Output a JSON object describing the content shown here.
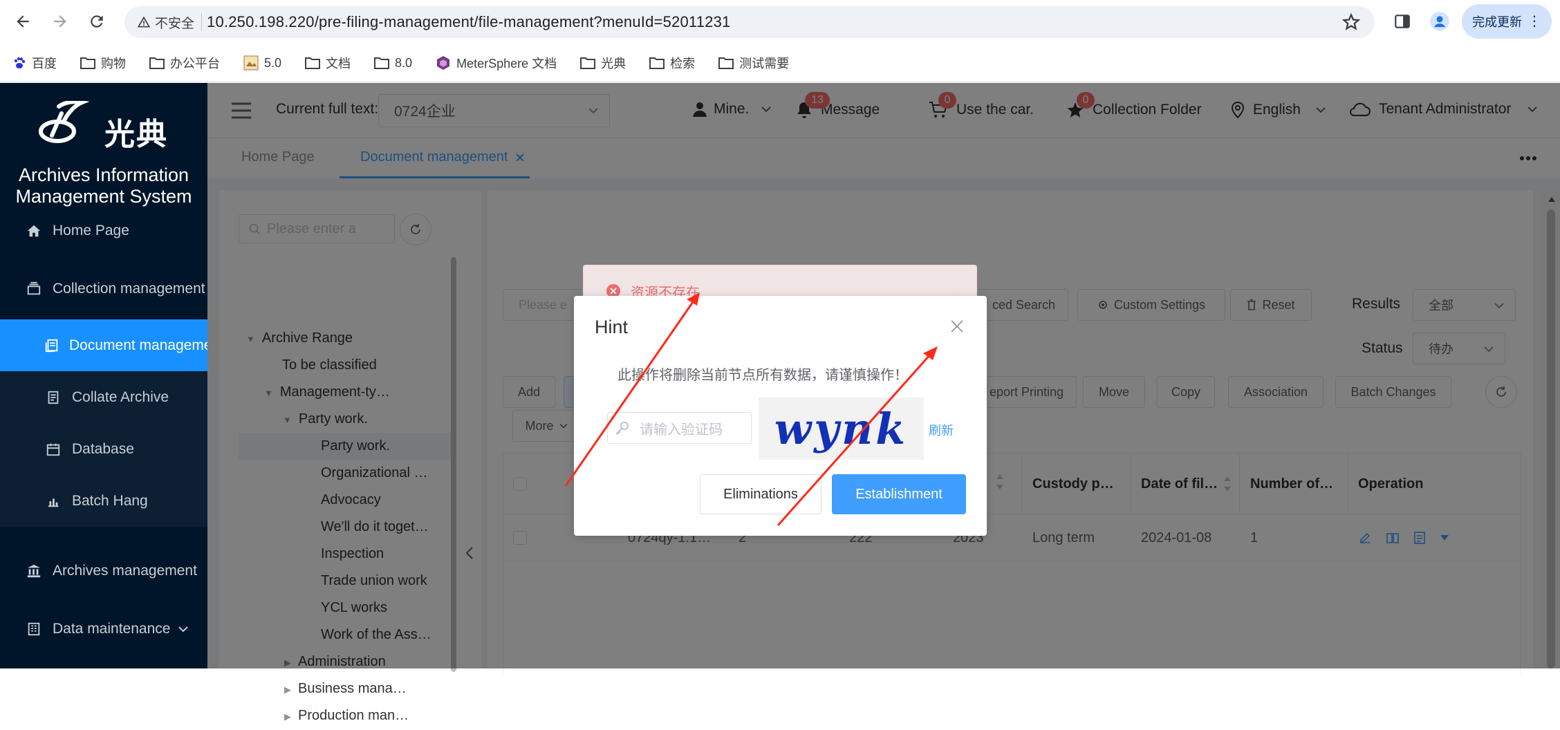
{
  "browser": {
    "security_label": "不安全",
    "url": "10.250.198.220/pre-filing-management/file-management?menuId=52011231",
    "update_label": "完成更新",
    "bookmarks": [
      "百度",
      "购物",
      "办公平台",
      "5.0",
      "文档",
      "8.0",
      "MeterSphere 文档",
      "光典",
      "检索",
      "测试需要"
    ]
  },
  "sidebar": {
    "logo_text": "光典",
    "system_title_line1": "Archives Information",
    "system_title_line2": "Management System",
    "items": [
      {
        "label": "Home Page",
        "icon": "home-icon"
      },
      {
        "label": "Collection management",
        "icon": "archive-box-icon"
      },
      {
        "label": "Document management",
        "icon": "documents-icon"
      },
      {
        "label": "Collate Archive",
        "icon": "file-icon"
      },
      {
        "label": "Database",
        "icon": "calendar-icon"
      },
      {
        "label": "Batch Hang",
        "icon": "bar-chart-icon"
      },
      {
        "label": "Archives management",
        "icon": "bank-icon"
      },
      {
        "label": "Data maintenance",
        "icon": "building-icon"
      }
    ]
  },
  "header": {
    "full_text_label": "Current full text:",
    "full_text_value": "0724企业",
    "mine_label": "Mine.",
    "message_label": "Message",
    "message_count": "13",
    "car_label": "Use the car.",
    "car_count": "0",
    "collection_label": "Collection Folder",
    "collection_count": "0",
    "language_label": "English",
    "tenant_label": "Tenant Administrator"
  },
  "tabs": [
    {
      "label": "Home Page"
    },
    {
      "label": "Document management"
    }
  ],
  "tree": {
    "search_placeholder": "Please enter a",
    "nodes": [
      {
        "label": "Archive Range"
      },
      {
        "label": "To be classified"
      },
      {
        "label": "Management-ty…"
      },
      {
        "label": "Party work."
      },
      {
        "label": "Party work."
      },
      {
        "label": "Organizational …"
      },
      {
        "label": "Advocacy"
      },
      {
        "label": "We'll do it toget…"
      },
      {
        "label": "Inspection"
      },
      {
        "label": "Trade union work"
      },
      {
        "label": "YCL works"
      },
      {
        "label": "Work of the Ass…"
      },
      {
        "label": "Administration"
      },
      {
        "label": "Business mana…"
      },
      {
        "label": "Production man…"
      }
    ]
  },
  "toolbar": {
    "search_placeholder": "Please e",
    "advanced_search": "ced Search",
    "custom_settings": "Custom Settings",
    "reset": "Reset",
    "results_label": "Results",
    "results_value": "全部",
    "status_label": "Status",
    "status_value": "待办",
    "add": "Add",
    "report_printing": "eport Printing",
    "move": "Move",
    "copy": "Copy",
    "association": "Association",
    "batch_changes": "Batch Changes",
    "more": "More"
  },
  "table": {
    "headers": [
      "Custody p…",
      "Date of fil…",
      "Number of…",
      "Operation"
    ],
    "row": {
      "code": "0724qy-1.1…",
      "c2": "2",
      "c3": "222",
      "c4": "2023",
      "custody": "Long term",
      "date": "2024-01-08",
      "number": "1"
    }
  },
  "toast": {
    "message": "资源不存在"
  },
  "dialog": {
    "title": "Hint",
    "message": "此操作将删除当前节点所有数据，请谨慎操作！",
    "captcha_placeholder": "请输入验证码",
    "captcha_text": "wynk",
    "refresh_label": "刷新",
    "cancel_label": "Eliminations",
    "confirm_label": "Establishment"
  },
  "colors": {
    "primary": "#409eff",
    "sidebar": "#001529",
    "active": "#1890ff",
    "danger": "#f56c6c",
    "annotation": "#ff2a1a"
  }
}
